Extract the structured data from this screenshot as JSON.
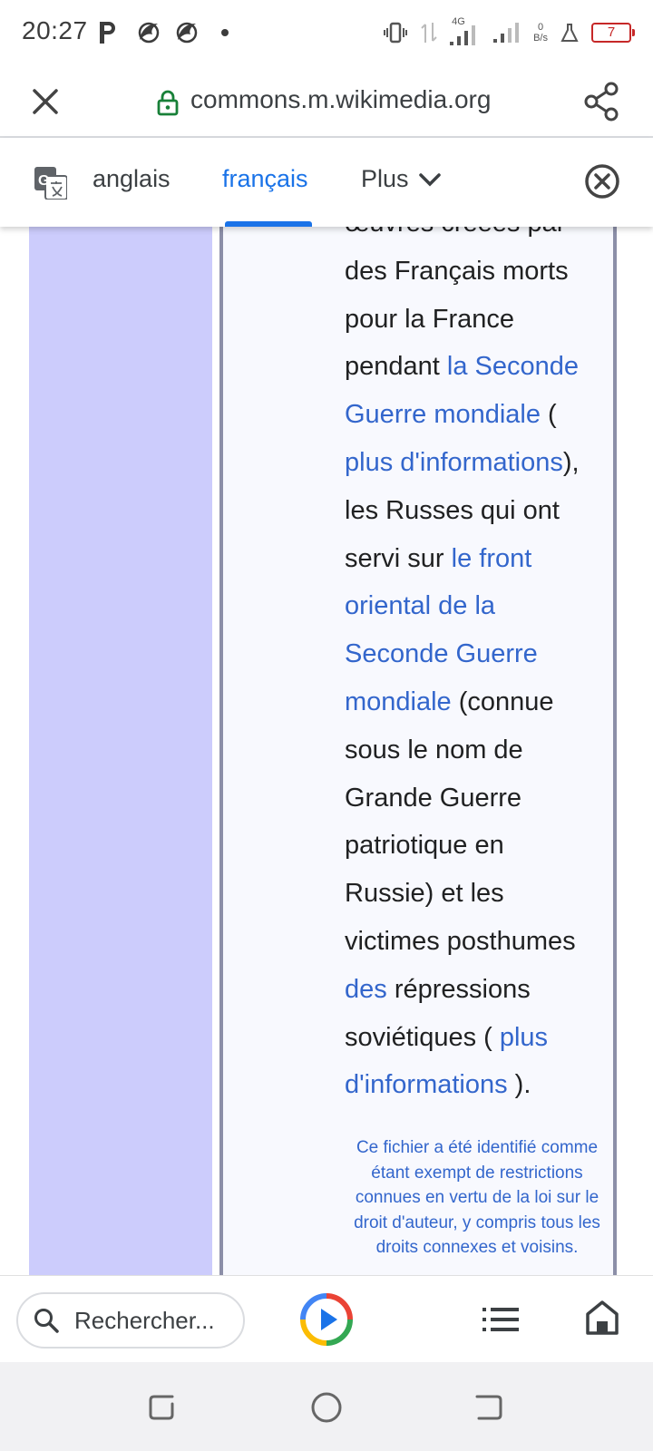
{
  "status": {
    "time": "20:27",
    "network": "4G",
    "speed_value": "0",
    "speed_unit": "B/s",
    "battery": "7"
  },
  "browser": {
    "url": "commons.m.wikimedia.org"
  },
  "translate": {
    "source_lang": "anglais",
    "target_lang": "français",
    "more_label": "Plus"
  },
  "content": {
    "lines": [
      [
        {
          "t": "œuvres créées par",
          "link": false
        }
      ],
      [
        {
          "t": "des Français morts",
          "link": false
        }
      ],
      [
        {
          "t": "pour la France",
          "link": false
        }
      ],
      [
        {
          "t": "pendant ",
          "link": false
        },
        {
          "t": "la Seconde",
          "link": true
        }
      ],
      [
        {
          "t": "Guerre mondiale",
          "link": true
        },
        {
          "t": " (",
          "link": false
        }
      ],
      [
        {
          "t": "plus d'informations",
          "link": true
        },
        {
          "t": "),",
          "link": false
        }
      ],
      [
        {
          "t": "les Russes qui ont",
          "link": false
        }
      ],
      [
        {
          "t": "servi sur ",
          "link": false
        },
        {
          "t": "le front",
          "link": true
        }
      ],
      [
        {
          "t": "oriental de la",
          "link": true
        }
      ],
      [
        {
          "t": "Seconde Guerre",
          "link": true
        }
      ],
      [
        {
          "t": "mondiale",
          "link": true
        },
        {
          "t": " (connue",
          "link": false
        }
      ],
      [
        {
          "t": "sous le nom de",
          "link": false
        }
      ],
      [
        {
          "t": "Grande Guerre",
          "link": false
        }
      ],
      [
        {
          "t": "patriotique en",
          "link": false
        }
      ],
      [
        {
          "t": "Russie) et les",
          "link": false
        }
      ],
      [
        {
          "t": "victimes posthumes",
          "link": false
        }
      ],
      [
        {
          "t": "des",
          "link": true
        },
        {
          "t": " répressions",
          "link": false
        }
      ],
      [
        {
          "t": "soviétiques ( ",
          "link": false
        },
        {
          "t": "plus",
          "link": true
        }
      ],
      [
        {
          "t": "d'informations",
          "link": true
        },
        {
          "t": " ).",
          "link": false
        }
      ]
    ],
    "note": "Ce fichier a été identifié comme étant exempt de restrictions connues en vertu de la loi sur le droit d'auteur, y compris tous les droits connexes et voisins."
  },
  "bottom_bar": {
    "search_placeholder": "Rechercher..."
  },
  "colors": {
    "link": "#3366cc",
    "accent": "#1a73e8",
    "side_column": "#ccccfc",
    "box_background": "#f8f9fe"
  },
  "icons": [
    "close-icon",
    "lock-icon",
    "share-icon",
    "google-translate-icon",
    "chevron-down-icon",
    "close-circle-icon",
    "search-icon",
    "play-icon",
    "list-icon",
    "home-icon",
    "recent-apps-icon",
    "home-circle-icon",
    "back-icon"
  ]
}
